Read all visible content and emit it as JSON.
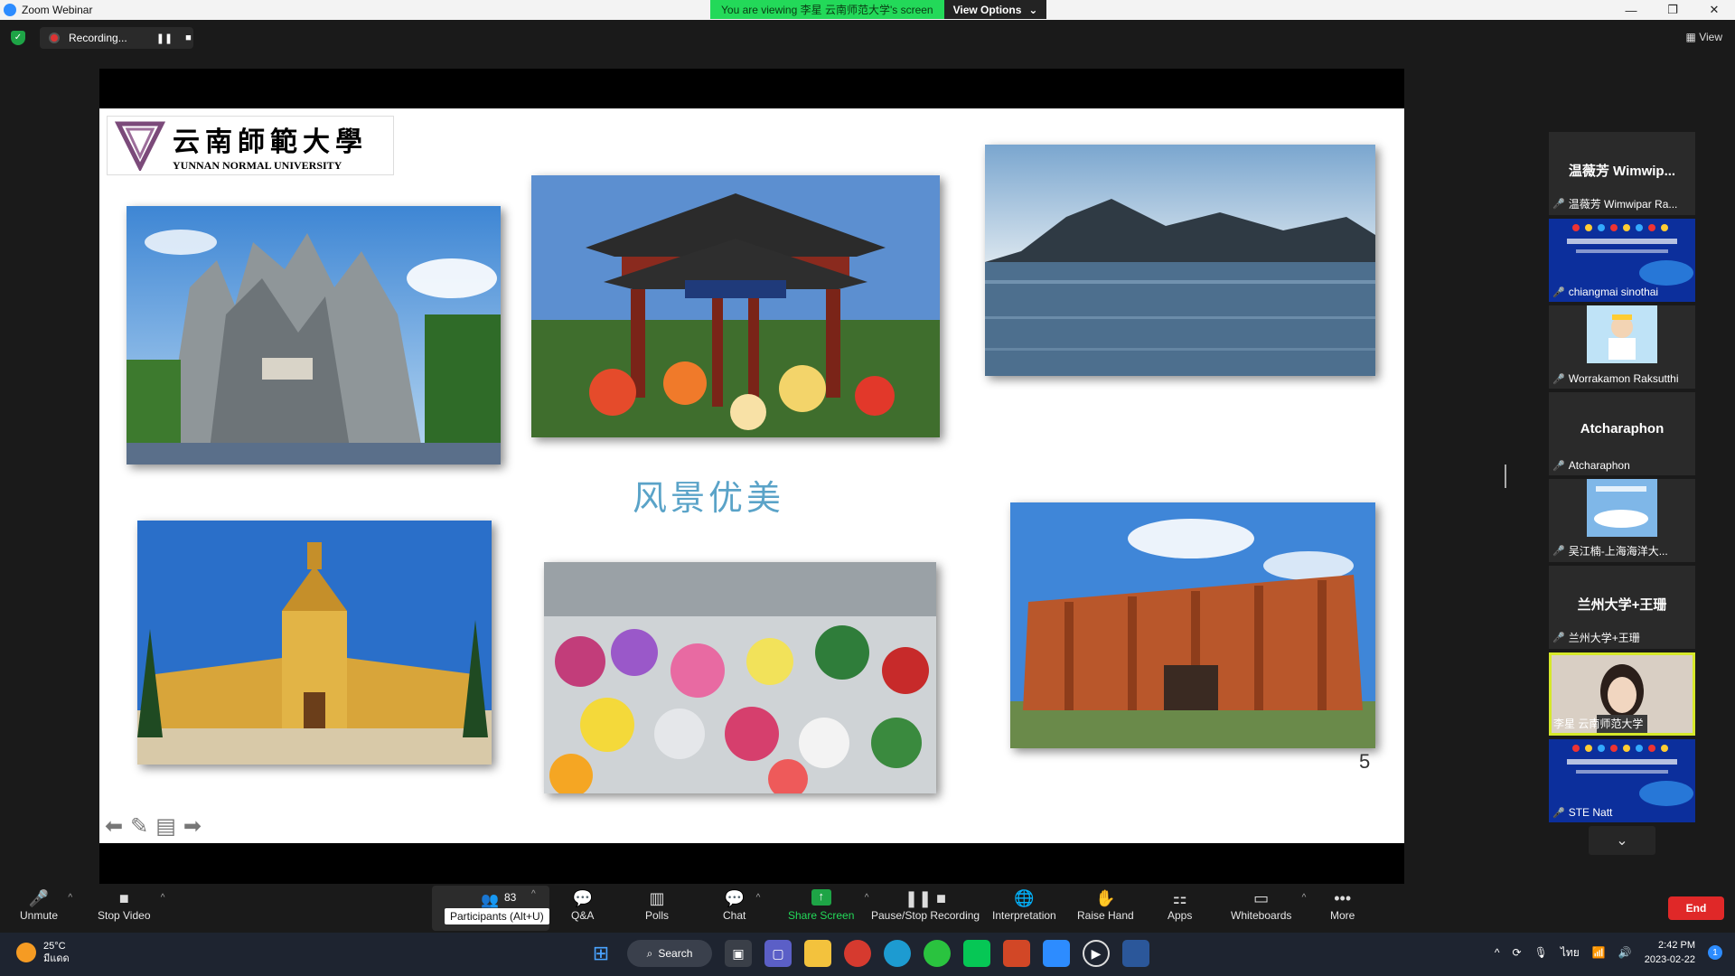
{
  "window": {
    "title": "Zoom Webinar",
    "viewing_text": "You are viewing 李星 云南师范大学's screen",
    "view_options": "View Options",
    "minimize": "—",
    "maximize": "❐",
    "close": "✕"
  },
  "recording": {
    "status": "Recording...",
    "pause": "❚❚",
    "stop": "■",
    "view_label": "View"
  },
  "slide": {
    "logo_cn": "云南師範大學",
    "logo_en": "YUNNAN NORMAL UNIVERSITY",
    "title": "风景优美",
    "page_number": "5"
  },
  "panel": {
    "tiles": [
      {
        "big": "温薇芳  Wimwip...",
        "name": "温薇芳 Wimwipar Ra...",
        "type": "name"
      },
      {
        "name": "chiangmai sinothai",
        "type": "banner"
      },
      {
        "name": "Worrakamon Raksutthi",
        "type": "cartoon"
      },
      {
        "big": "Atcharaphon",
        "name": "Atcharaphon",
        "type": "name"
      },
      {
        "name": "吴江楠-上海海洋大...",
        "type": "sky"
      },
      {
        "big": "兰州大学+王珊",
        "name": "兰州大学+王珊",
        "type": "name"
      },
      {
        "name": "李星 云南师范大学",
        "type": "person"
      },
      {
        "name": "STE Natt",
        "type": "banner"
      }
    ]
  },
  "toolbar": {
    "unmute": "Unmute",
    "stop_video": "Stop Video",
    "participants_count": "83",
    "participants_tooltip": "Participants (Alt+U)",
    "qa": "Q&A",
    "polls": "Polls",
    "chat": "Chat",
    "share_screen": "Share Screen",
    "pause_recording": "Pause/Stop Recording",
    "interpretation": "Interpretation",
    "raise_hand": "Raise Hand",
    "apps": "Apps",
    "whiteboards": "Whiteboards",
    "more": "More",
    "end": "End"
  },
  "taskbar": {
    "temperature": "25°C",
    "weather_desc": "มีแดด",
    "search": "Search",
    "time": "2:42 PM",
    "date": "2023-02-22",
    "lang": "ไทย",
    "notifications": "1"
  }
}
